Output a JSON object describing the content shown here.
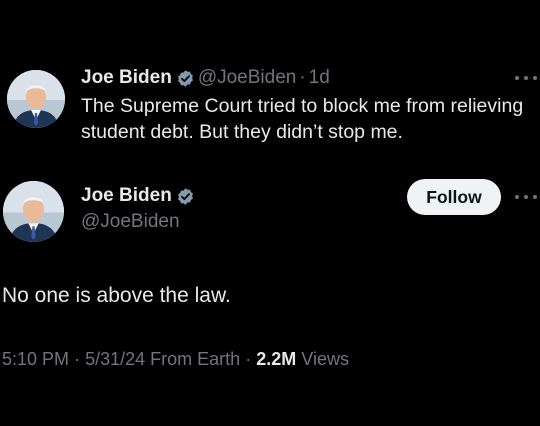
{
  "previous_tweet": {
    "author_name": "Joe Biden",
    "handle": "@JoeBiden",
    "separator": "·",
    "age": "1d",
    "text": "The Supreme Court tried to block me from relieving student debt. But they didn’t stop me."
  },
  "main_tweet": {
    "author_name": "Joe Biden",
    "handle": "@JoeBiden",
    "follow_label": "Follow",
    "text": "No one is above the law.",
    "time": "5:10 PM",
    "separator": "·",
    "date": "5/31/24",
    "source": "From Earth",
    "views_count": "2.2M",
    "views_label": "Views"
  },
  "colors": {
    "background": "#000000",
    "primary_text": "#e7e9ea",
    "secondary_text": "#71767b",
    "verified_badge": "#829aab",
    "follow_button": "#eff3f4"
  },
  "icons": {
    "verified": "verified-badge-icon",
    "more": "more-dots-icon"
  }
}
